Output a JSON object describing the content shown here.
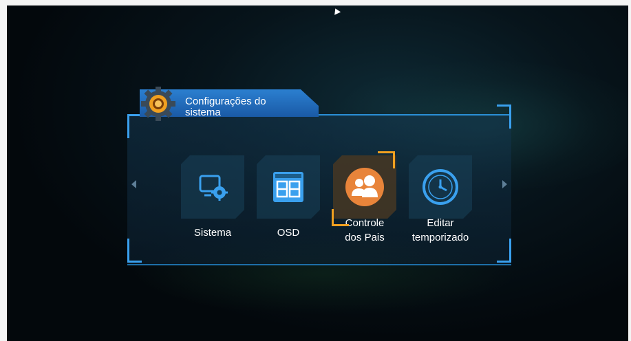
{
  "window": {
    "title_line1": "Configurações do",
    "title_line2": "sistema"
  },
  "menu": {
    "items": [
      {
        "label": "Sistema",
        "icon": "monitor-gear-icon",
        "selected": false
      },
      {
        "label": "OSD",
        "icon": "osd-layout-icon",
        "selected": false
      },
      {
        "label_line1": "Controle",
        "label_line2": "dos Pais",
        "icon": "parental-users-icon",
        "selected": true
      },
      {
        "label_line1": "Editar",
        "label_line2": "temporizado",
        "icon": "clock-icon",
        "selected": false
      }
    ]
  },
  "colors": {
    "accent_blue": "#2b7fd0",
    "selection_orange": "#f0a020",
    "icon_blue": "#3aa0ee"
  }
}
